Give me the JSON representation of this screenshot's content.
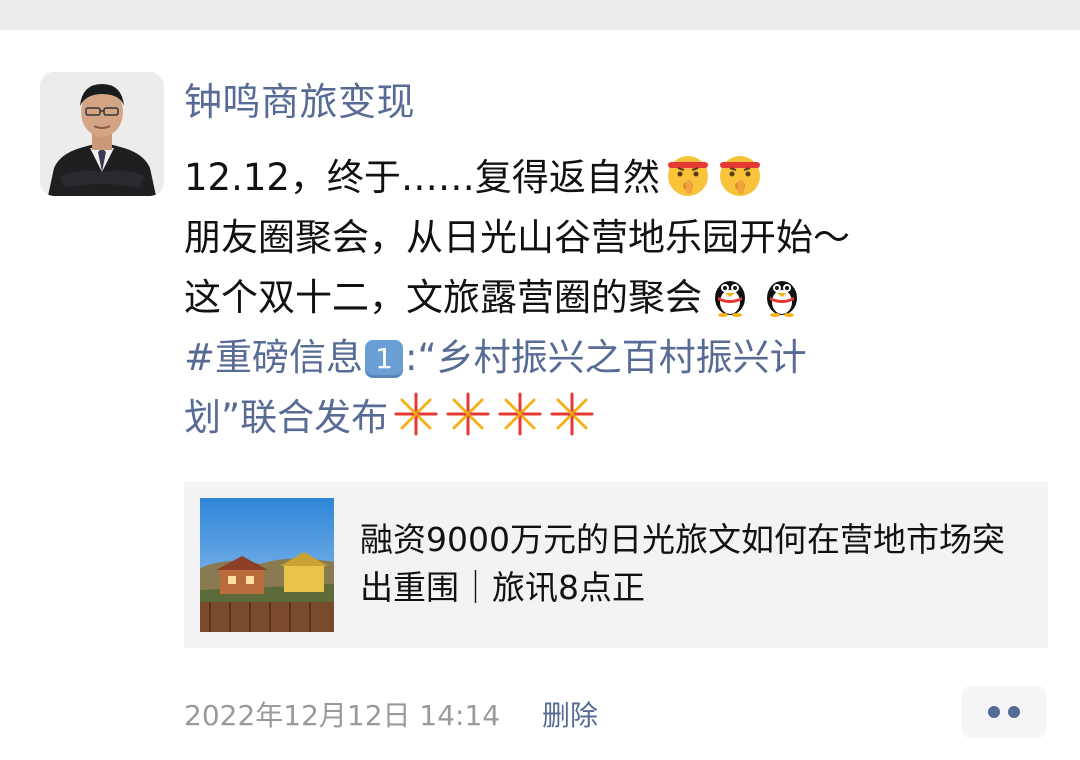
{
  "post": {
    "author": "钟鸣商旅变现",
    "lines": {
      "l1": "12.12，终于……复得返自然",
      "l2": "朋友圈聚会，从日光山谷营地乐园开始～",
      "l3": "这个双十二，文旅露营圈的聚会",
      "l4_prefix": "#重磅信息",
      "l4_badge": "1",
      "l4_suffix": ":“乡村振兴之百村振兴计",
      "l5": "划”联合发布"
    },
    "emojis": {
      "line1": [
        "shushing-face",
        "shushing-face"
      ],
      "line3": [
        "penguin-emoji",
        "penguin-emoji"
      ],
      "line5": [
        "firework-emoji",
        "firework-emoji",
        "firework-emoji",
        "firework-emoji"
      ]
    }
  },
  "link_card": {
    "title": "融资9000万元的日光旅文如何在营地市场突出重围｜旅讯8点正"
  },
  "footer": {
    "timestamp": "2022年12月12日 14:14",
    "delete_label": "删除"
  },
  "colors": {
    "link": "#576b95",
    "text": "#111111",
    "meta": "#9a9a9a",
    "card_bg": "#f3f3f5",
    "top_strip": "#ededed"
  }
}
